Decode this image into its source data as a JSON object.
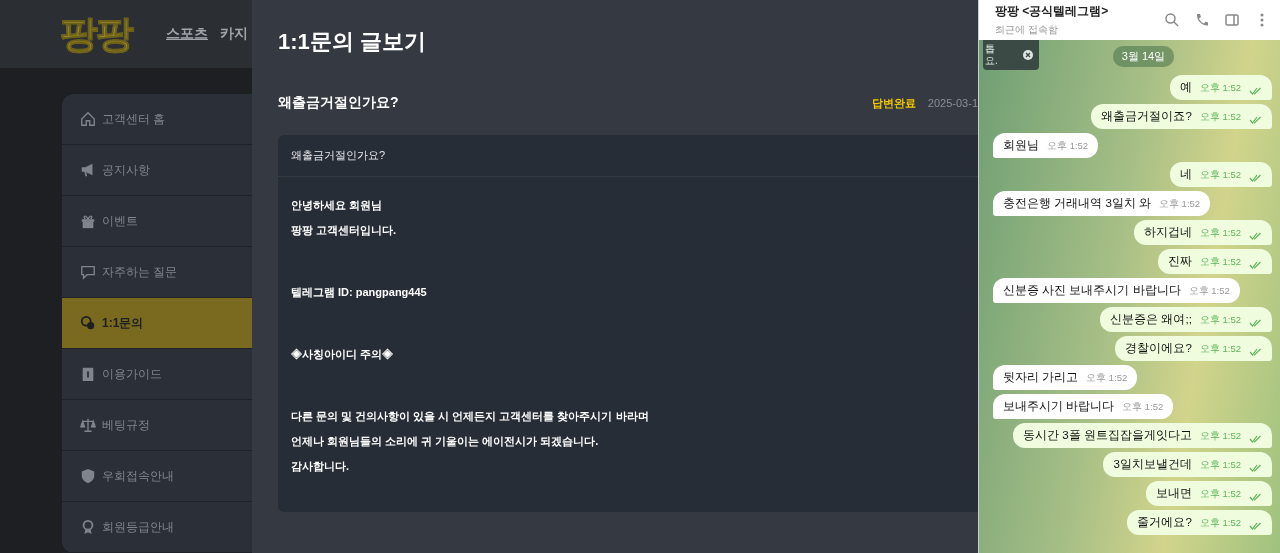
{
  "site": {
    "logo": "팡팡",
    "nav": [
      {
        "label": "스포츠",
        "selected": true
      },
      {
        "label": "카지",
        "selected": false
      }
    ]
  },
  "sidebar": {
    "items": [
      {
        "label": "고객센터 홈",
        "selected": false
      },
      {
        "label": "공지사항",
        "selected": false
      },
      {
        "label": "이벤트",
        "selected": false
      },
      {
        "label": "자주하는 질문",
        "selected": false
      },
      {
        "label": "1:1문의",
        "selected": true
      },
      {
        "label": "이용가이드",
        "selected": false
      },
      {
        "label": "베팅규정",
        "selected": false
      },
      {
        "label": "우회접속안내",
        "selected": false
      },
      {
        "label": "회원등급안내",
        "selected": false
      }
    ]
  },
  "inquiry": {
    "title": "1:1문의 글보기",
    "subject": "왜출금거절인가요?",
    "status": "답변완료",
    "date": "2025-03-1",
    "box_header": "왜출금거절인가요?",
    "paragraphs": [
      [
        "안녕하세요 회원님",
        "팡팡 고객센터입니다."
      ],
      [
        "텔레그램 ID: pangpang445"
      ],
      [
        "◈사칭아이디 주의◈"
      ],
      [
        "다른 문의 및 건의사항이 있을 시 언제든지 고객센터를 찾아주시기 바라며",
        "언제나 회원님들의 소리에 귀 기울이는 에이전시가 되겠습니다.",
        "감사합니다."
      ]
    ]
  },
  "chat": {
    "name": "팡팡 <공식텔레그램>",
    "status": "최근에 접속함",
    "toast": [
      "톱",
      "요."
    ],
    "date": "3월 14일",
    "messages": [
      {
        "kind": "out",
        "text": "예",
        "time": "오후 1:52"
      },
      {
        "kind": "out",
        "text": "왜출금거절이죠?",
        "time": "오후 1:52"
      },
      {
        "kind": "in",
        "text": "회원님",
        "time": "오후 1:52"
      },
      {
        "kind": "out",
        "text": "네",
        "time": "오후 1:52"
      },
      {
        "kind": "in",
        "text": "충전은행 거래내역 3일치 와",
        "time": "오후 1:52"
      },
      {
        "kind": "out",
        "text": "하지겁네",
        "time": "오후 1:52"
      },
      {
        "kind": "out",
        "text": "진짜",
        "time": "오후 1:52"
      },
      {
        "kind": "in",
        "text": "신분증 사진 보내주시기 바랍니다",
        "time": "오후 1:52"
      },
      {
        "kind": "out",
        "text": "신분증은 왜여;;",
        "time": "오후 1:52"
      },
      {
        "kind": "out",
        "text": "경찰이에요?",
        "time": "오후 1:52"
      },
      {
        "kind": "in",
        "text": "뒷자리 가리고",
        "time": "오후 1:52"
      },
      {
        "kind": "in",
        "text": "보내주시기 바랍니다",
        "time": "오후 1:52"
      },
      {
        "kind": "out",
        "text": "동시간 3폴 원트집잡을게잇다고",
        "time": "오후 1:52"
      },
      {
        "kind": "out",
        "text": "3일치보낼건데",
        "time": "오후 1:52"
      },
      {
        "kind": "out",
        "text": "보내면",
        "time": "오후 1:52"
      },
      {
        "kind": "out",
        "text": "줄거에요?",
        "time": "오후 1:52"
      }
    ]
  }
}
